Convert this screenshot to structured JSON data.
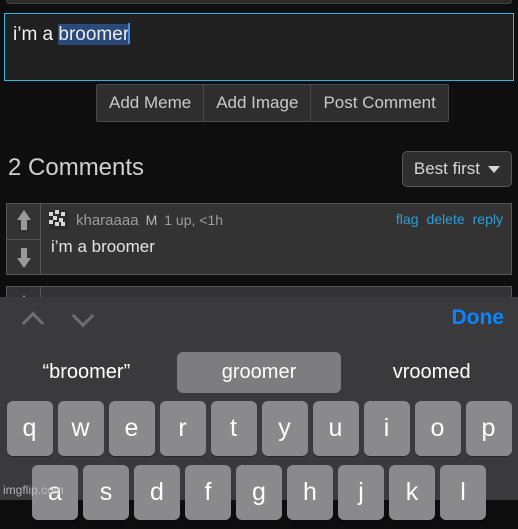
{
  "composer": {
    "text_prefix": "i’m a ",
    "text_selected": "broomer",
    "buttons": [
      {
        "label": "Add Meme",
        "name": "add-meme-button"
      },
      {
        "label": "Add Image",
        "name": "add-image-button"
      },
      {
        "label": "Post Comment",
        "name": "post-comment-button"
      }
    ]
  },
  "comments_section": {
    "title": "2 Comments",
    "sort_label": "Best first",
    "comments": [
      {
        "username": "kharaaaa",
        "badge": "M",
        "stats": "1 up, <1h",
        "body": "i’m a broomer",
        "actions": [
          "flag",
          "delete",
          "reply"
        ]
      },
      {
        "username": "",
        "badge": "",
        "stats": "",
        "body": "",
        "actions": []
      }
    ]
  },
  "keyboard": {
    "done_label": "Done",
    "suggestions": [
      {
        "label": "“broomer”",
        "active": false
      },
      {
        "label": "groomer",
        "active": true
      },
      {
        "label": "vroomed",
        "active": false
      }
    ],
    "row1": [
      "q",
      "w",
      "e",
      "r",
      "t",
      "y",
      "u",
      "i",
      "o",
      "p"
    ],
    "row2": [
      "a",
      "s",
      "d",
      "f",
      "g",
      "h",
      "j",
      "k",
      "l"
    ]
  },
  "watermark": "imgflip.com",
  "colors": {
    "accent_border": "#29b6e8",
    "link": "#2a9fd6",
    "ios_blue": "#0a84ff",
    "selection": "#2c4a77"
  }
}
